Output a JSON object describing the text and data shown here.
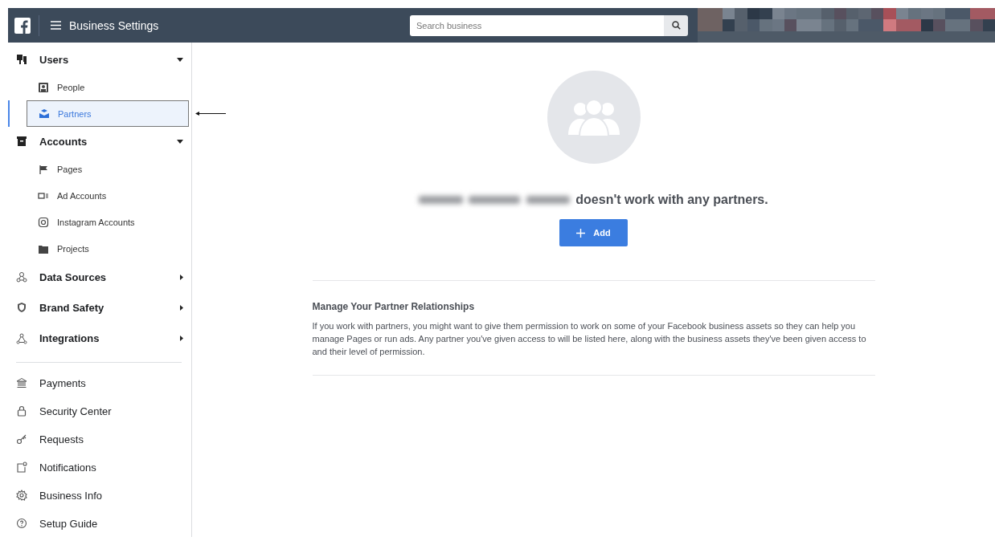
{
  "header": {
    "title": "Business Settings",
    "search": {
      "placeholder": "Search business"
    }
  },
  "sidebar": {
    "items": [
      {
        "kind": "group",
        "label": "Users",
        "expanded": true,
        "children": [
          {
            "label": "People",
            "selected": false
          },
          {
            "label": "Partners",
            "selected": true
          }
        ]
      },
      {
        "kind": "group",
        "label": "Accounts",
        "expanded": true,
        "children": [
          {
            "label": "Pages",
            "selected": false
          },
          {
            "label": "Ad Accounts",
            "selected": false
          },
          {
            "label": "Instagram Accounts",
            "selected": false
          },
          {
            "label": "Projects",
            "selected": false
          }
        ]
      },
      {
        "kind": "group",
        "label": "Data Sources",
        "expanded": false
      },
      {
        "kind": "group",
        "label": "Brand Safety",
        "expanded": false
      },
      {
        "kind": "group",
        "label": "Integrations",
        "expanded": false
      },
      {
        "kind": "divider"
      },
      {
        "kind": "link",
        "label": "Payments"
      },
      {
        "kind": "link",
        "label": "Security Center"
      },
      {
        "kind": "link",
        "label": "Requests"
      },
      {
        "kind": "link",
        "label": "Notifications"
      },
      {
        "kind": "link",
        "label": "Business Info"
      },
      {
        "kind": "link",
        "label": "Setup Guide"
      }
    ]
  },
  "empty_state": {
    "message": "doesn't work with any partners.",
    "button": "Add"
  },
  "info": {
    "title": "Manage Your Partner Relationships",
    "text": "If you work with partners, you might want to give them permission to work on some of your Facebook business assets so they can help you manage Pages or run ads. Any partner you've given access to will be listed here, along with the business assets they've been given access to and their level of permission."
  }
}
